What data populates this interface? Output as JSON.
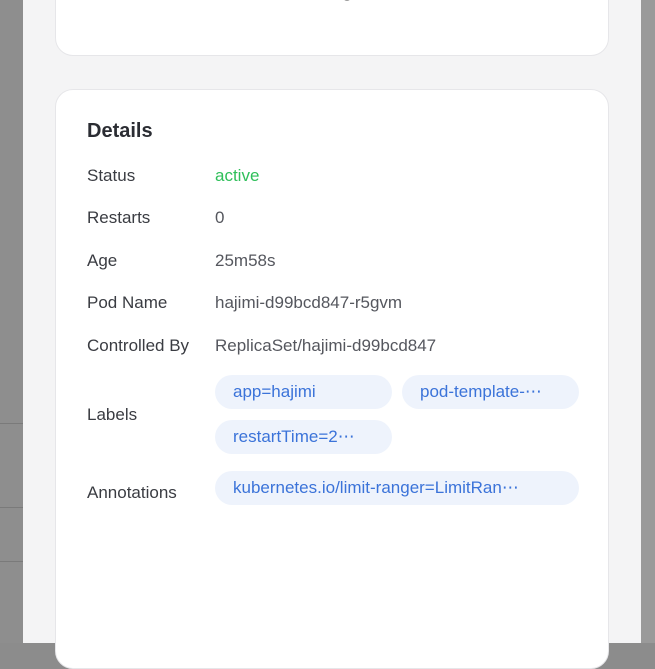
{
  "details": {
    "title": "Details",
    "status": {
      "label": "Status",
      "value": "active",
      "color": "#2fbf5a"
    },
    "restarts": {
      "label": "Restarts",
      "value": "0"
    },
    "age": {
      "label": "Age",
      "value": "25m58s"
    },
    "pod_name": {
      "label": "Pod Name",
      "value": "hajimi-d99bcd847-r5gvm"
    },
    "controlled_by": {
      "label": "Controlled By",
      "value": "ReplicaSet/hajimi-d99bcd847"
    },
    "labels": {
      "label": "Labels",
      "items": [
        "app=hajimi",
        "pod-template-⋯",
        "restartTime=2⋯"
      ]
    },
    "annotations": {
      "label": "Annotations",
      "items": [
        "kubernetes.io/limit-ranger=LimitRan⋯"
      ]
    }
  }
}
